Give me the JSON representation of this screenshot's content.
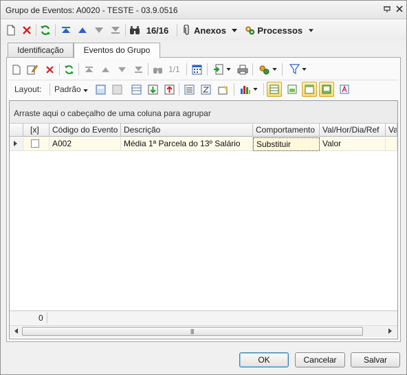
{
  "window": {
    "title": "Grupo de Eventos: A0020 - TESTE - 03.9.0516",
    "pin_icon": "pin-icon",
    "close_icon": "close-icon"
  },
  "toolbar": {
    "record_counter": "16/16",
    "attachments_label": "Anexos",
    "processes_label": "Processos"
  },
  "tabs": [
    {
      "label": "Identificação",
      "active": false
    },
    {
      "label": "Eventos do Grupo",
      "active": true
    }
  ],
  "grid_toolbar": {
    "record_counter": "1/1",
    "layout_label": "Layout:",
    "layout_value": "Padrão"
  },
  "grid": {
    "group_hint": "Arraste aqui o cabeçalho de uma coluna para agrupar",
    "columns": [
      "[x]",
      "Código do Evento",
      "Descrição",
      "Comportamento",
      "Val/Hor/Dia/Ref",
      "Va"
    ],
    "rows": [
      {
        "checked": false,
        "code": "A002",
        "description": "Média 1ª Parcela do 13º Salário",
        "behavior": "Substituir",
        "type": "Valor"
      }
    ],
    "footer_count": "0"
  },
  "buttons": {
    "ok": "OK",
    "cancel": "Cancelar",
    "save": "Salvar"
  },
  "colors": {
    "accent_highlight": "#ffd86a",
    "row_highlight": "#fefbe9",
    "delete_red": "#d42020",
    "refresh_green": "#1f9a2d",
    "nav_blue": "#2b62c8"
  }
}
